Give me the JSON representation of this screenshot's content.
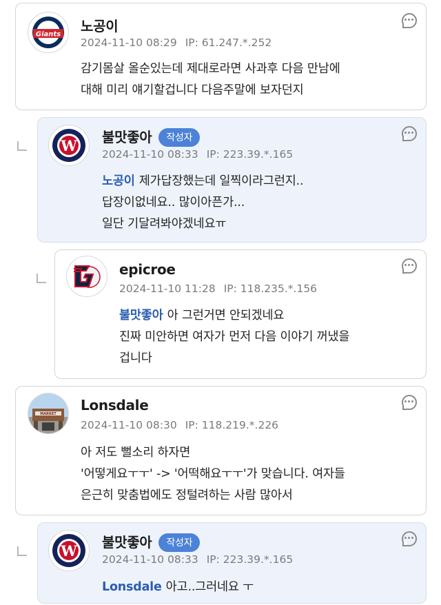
{
  "comments": [
    {
      "author": "노공이",
      "avatar": "giants-logo",
      "date": "2024-11-10 08:29",
      "ip": "IP: 61.247.*.252",
      "lines": [
        "감기몸살 올순있는데 제대로라면 사과후 다음 만남에",
        "대해 미리 얘기할겁니다 다음주말에 보자던지"
      ]
    },
    {
      "author": "불맛좋아",
      "badge": "작성자",
      "avatar": "washington-nationals-logo",
      "date": "2024-11-10 08:33",
      "ip": "IP: 223.39.*.165",
      "mention": "노공이",
      "lines": [
        "제가답장했는데 일찍이라그런지..",
        "답장이없네요.. 많이아픈가...",
        "일단 기달려봐야겠네요ㅠ"
      ]
    },
    {
      "author": "epicroe",
      "avatar": "cleveland-guardians-logo",
      "date": "2024-11-10 11:28",
      "ip": "IP: 118.235.*.156",
      "mention": "불맛좋아",
      "lines": [
        "아 그런거면 안되겠네요",
        "진짜 미안하면 여자가 먼저 다음 이야기 꺼냈을",
        "겁니다"
      ]
    },
    {
      "author": "Lonsdale",
      "avatar": "stadium-photo",
      "date": "2024-11-10 08:30",
      "ip": "IP: 118.219.*.226",
      "lines": [
        "아 저도 뻘소리 하자면",
        "'어떻게요ㅜㅜ' -> '어떡해요ㅜㅜ'가 맞습니다. 여자들",
        "은근히 맞춤법에도 정털려하는 사람 많아서"
      ]
    },
    {
      "author": "불맛좋아",
      "badge": "작성자",
      "avatar": "washington-nationals-logo",
      "date": "2024-11-10 08:33",
      "ip": "IP: 223.39.*.165",
      "mention": "Lonsdale",
      "lines": [
        "아고..그러네요 ㅜ"
      ]
    }
  ],
  "colors": {
    "mention": "#2a5db0",
    "badge": "#4c82d8",
    "reply_background": "#eef3fb"
  }
}
